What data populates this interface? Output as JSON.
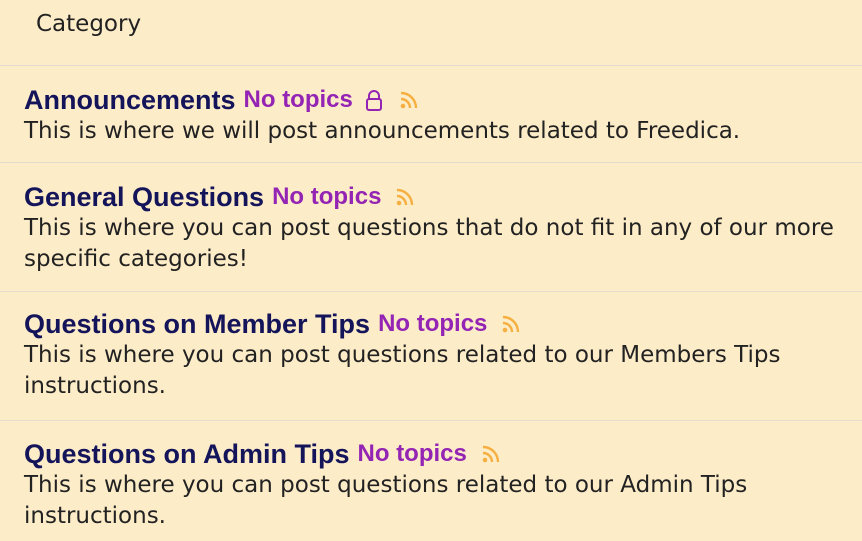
{
  "header": {
    "category_label": "Category"
  },
  "colors": {
    "background": "#fdecc8",
    "title": "#14145a",
    "topic_count": "#9424b4",
    "rss": "#f5b041",
    "text": "#222222"
  },
  "categories": [
    {
      "title": "Announcements",
      "topics": "No topics",
      "locked": true,
      "description": "This is where we will post announcements related to Freedica.",
      "icons": [
        "lock-icon",
        "rss-icon"
      ]
    },
    {
      "title": "General Questions",
      "topics": "No topics",
      "locked": false,
      "description": "This is where you can post questions that do not fit in any of our more specific categories!",
      "icons": [
        "rss-icon"
      ]
    },
    {
      "title": "Questions on Member Tips",
      "topics": "No topics",
      "locked": false,
      "description": "This is where you can post questions related to our Members Tips instructions.",
      "icons": [
        "rss-icon"
      ]
    },
    {
      "title": "Questions on Admin Tips",
      "topics": "No topics",
      "locked": false,
      "description": "This is where you can post questions related to our Admin Tips instructions.",
      "icons": [
        "rss-icon"
      ]
    }
  ]
}
